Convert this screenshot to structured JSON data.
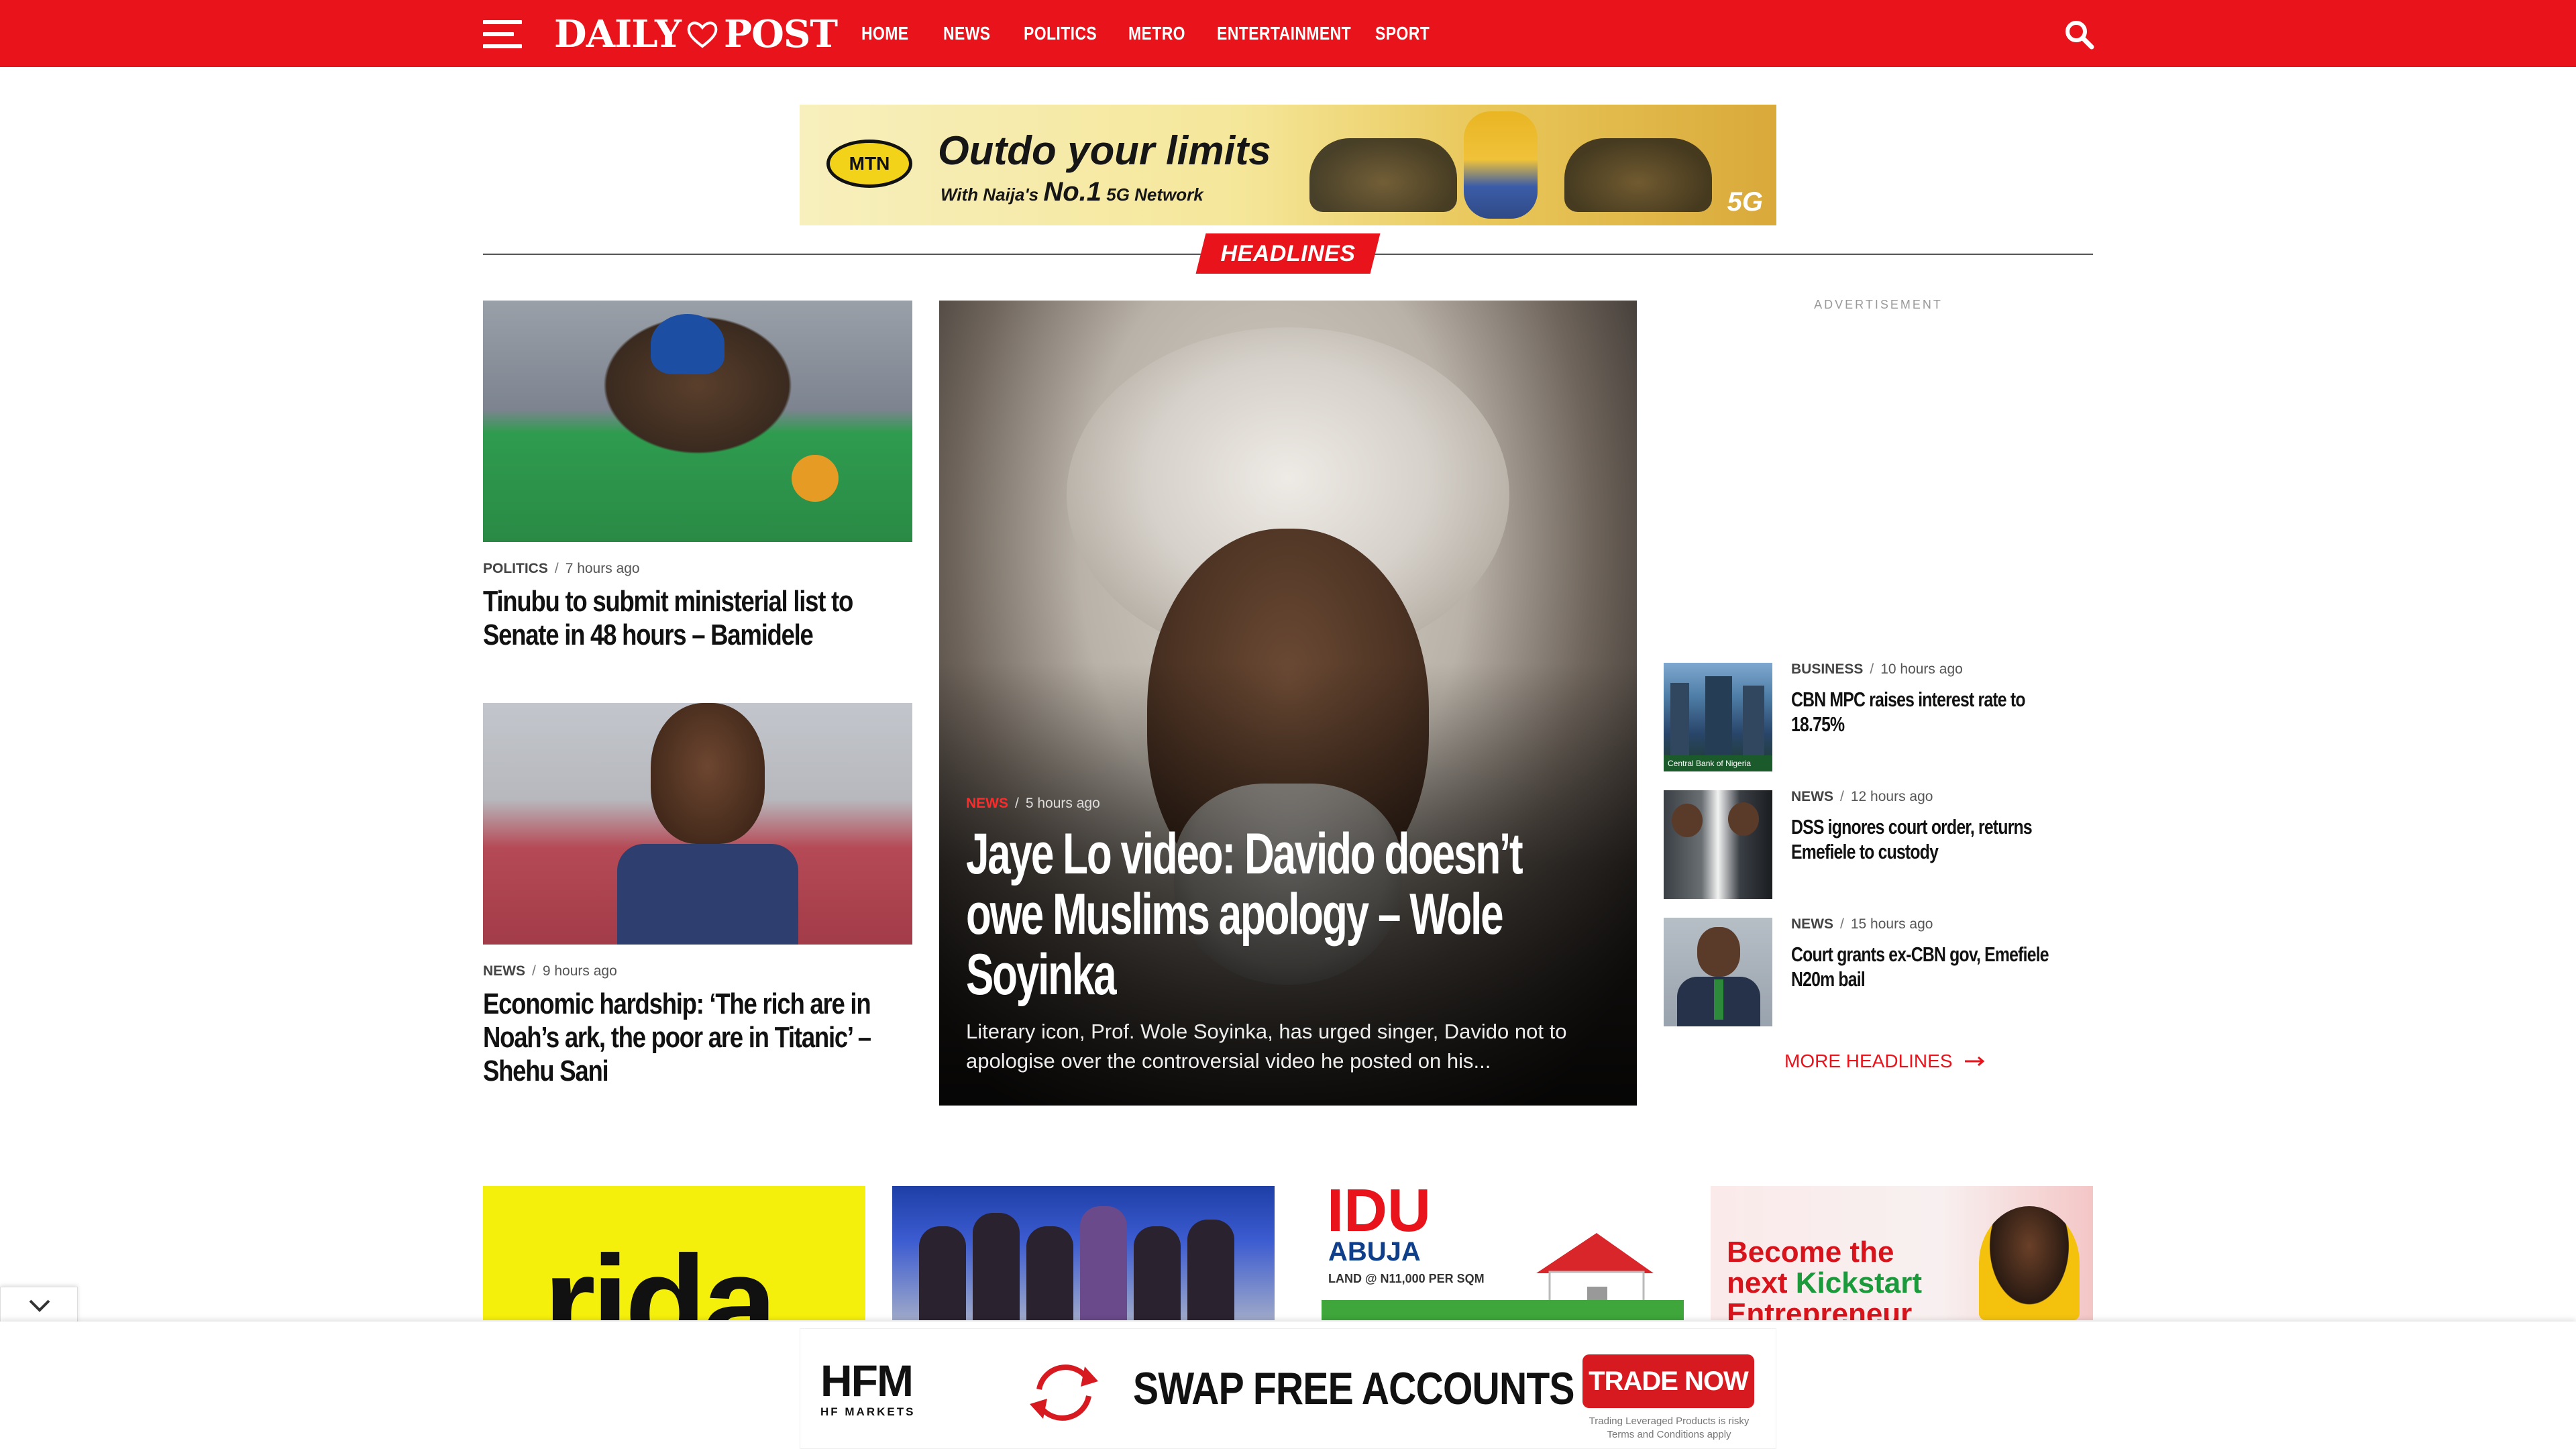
{
  "header": {
    "logo": {
      "left": "DAILY",
      "right": "POST"
    },
    "nav": [
      "HOME",
      "NEWS",
      "POLITICS",
      "METRO",
      "ENTERTAINMENT",
      "SPORT"
    ],
    "brand_color": "#e8131b"
  },
  "top_ad": {
    "brand": "MTN",
    "slogan": "Outdo your limits",
    "sub_prefix": "With Naija's",
    "sub_big": "No.1",
    "sub_suffix": "5G Network",
    "badge": "5G"
  },
  "section_label": "HEADLINES",
  "left_articles": [
    {
      "category": "POLITICS",
      "time": "7 hours ago",
      "title": "Tinubu to submit ministerial list to Senate in 48 hours – Bamidele"
    },
    {
      "category": "NEWS",
      "time": "9 hours ago",
      "title": "Economic hardship: ‘The rich are in Noah’s ark, the poor are in Titanic’ – Shehu Sani"
    }
  ],
  "featured": {
    "category": "NEWS",
    "time": "5 hours ago",
    "title": "Jaye Lo video: Davido doesn’t owe Muslims apology – Wole Soyinka",
    "excerpt": "Literary icon, Prof. Wole Soyinka, has urged singer, Davido not to apologise over the controversial video he posted on his..."
  },
  "sidebar": {
    "advertisement_label": "ADVERTISEMENT",
    "items": [
      {
        "category": "BUSINESS",
        "time": "10 hours ago",
        "title": "CBN MPC raises interest rate to 18.75%",
        "thumb_caption": "Central Bank of Nigeria"
      },
      {
        "category": "NEWS",
        "time": "12 hours ago",
        "title": "DSS ignores court order, returns Emefiele to custody"
      },
      {
        "category": "NEWS",
        "time": "15 hours ago",
        "title": "Court grants ex-CBN gov, Emefiele N20m bail"
      }
    ],
    "more_label": "MORE HEADLINES"
  },
  "bottom_tiles": {
    "tile1_text": "rida",
    "tile3": {
      "brand": "IDU",
      "city": "ABUJA",
      "price": "LAND @ N11,000 PER SQM"
    },
    "tile4": {
      "line1": "Become the",
      "line2a": "next ",
      "line2b": "Kickstart",
      "line3": "Entrepreneur"
    }
  },
  "bottom_ad": {
    "brand": "HFM",
    "brand_sub": "HF MARKETS",
    "headline": "SWAP FREE ACCOUNTS",
    "cta": "TRADE NOW",
    "disclaimer_1": "Trading Leveraged Products is risky",
    "disclaimer_2": "Terms and Conditions apply"
  }
}
